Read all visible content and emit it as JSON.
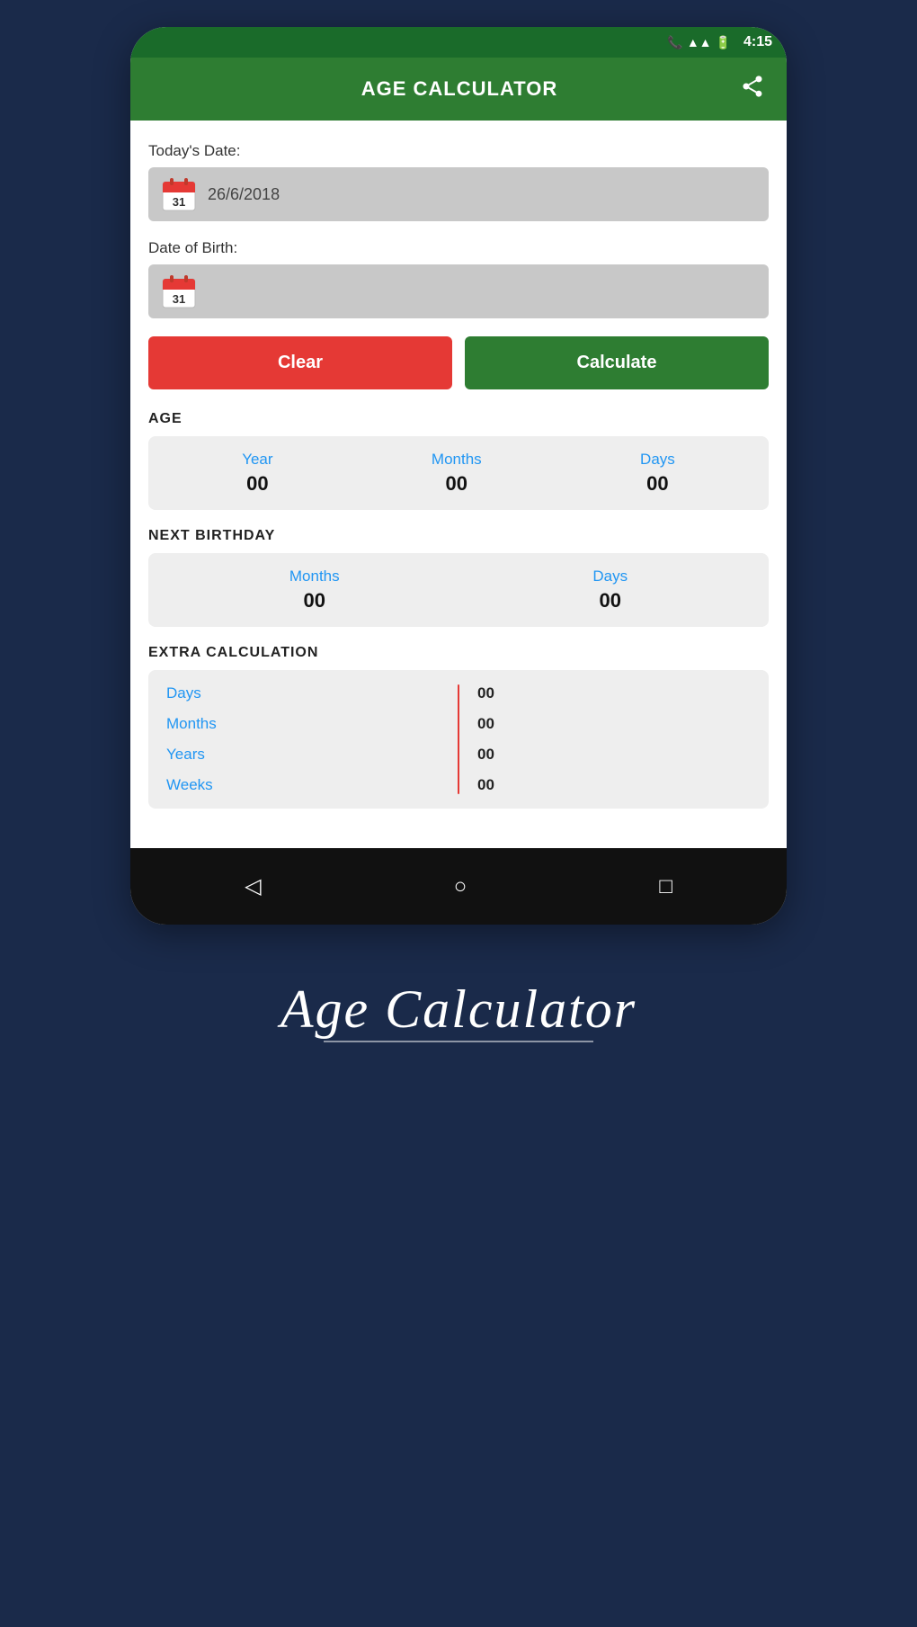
{
  "status_bar": {
    "time": "4:15"
  },
  "header": {
    "title": "AGE CALCULATOR",
    "share_label": "share"
  },
  "todays_date": {
    "label": "Today's Date:",
    "value": "26/6/2018",
    "placeholder": ""
  },
  "date_of_birth": {
    "label": "Date of Birth:",
    "value": ""
  },
  "buttons": {
    "clear": "Clear",
    "calculate": "Calculate"
  },
  "age_section": {
    "title": "AGE",
    "columns": [
      {
        "label": "Year",
        "value": "00"
      },
      {
        "label": "Months",
        "value": "00"
      },
      {
        "label": "Days",
        "value": "00"
      }
    ]
  },
  "next_birthday_section": {
    "title": "NEXT BIRTHDAY",
    "columns": [
      {
        "label": "Months",
        "value": "00"
      },
      {
        "label": "Days",
        "value": "00"
      }
    ]
  },
  "extra_calc_section": {
    "title": "EXTRA CALCULATION",
    "rows": [
      {
        "label": "Days",
        "value": "00"
      },
      {
        "label": "Months",
        "value": "00"
      },
      {
        "label": "Years",
        "value": "00"
      },
      {
        "label": "Weeks",
        "value": "00"
      }
    ]
  },
  "bottom_brand": {
    "text": "Age Calculator"
  },
  "colors": {
    "header_bg": "#2e7d32",
    "clear_btn": "#e53935",
    "calculate_btn": "#2e7d32",
    "label_blue": "#2196F3",
    "divider_red": "#e53935"
  }
}
